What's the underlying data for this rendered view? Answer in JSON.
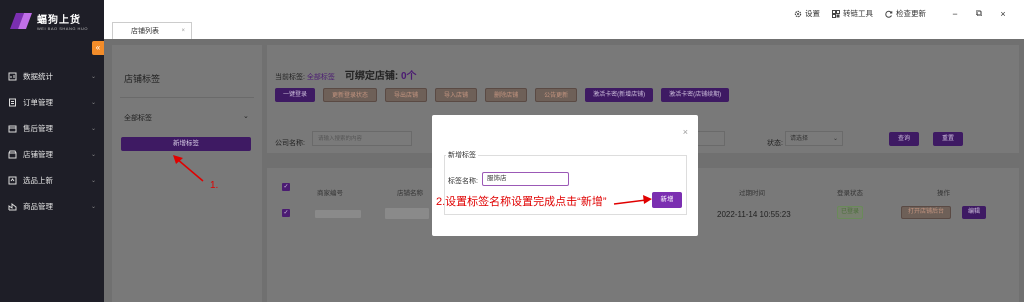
{
  "app": {
    "logo_title": "蝠狗上货",
    "logo_subtitle": "WEI BAO SHANG HUO"
  },
  "sidebar": {
    "collapse_glyph": "«",
    "items": [
      {
        "label": "数据统计",
        "icon": "chart-icon"
      },
      {
        "label": "订单管理",
        "icon": "order-icon"
      },
      {
        "label": "售后管理",
        "icon": "after-sales-icon"
      },
      {
        "label": "店铺管理",
        "icon": "store-icon"
      },
      {
        "label": "选品上新",
        "icon": "upload-icon"
      },
      {
        "label": "商品管理",
        "icon": "goods-icon"
      }
    ]
  },
  "tabs": [
    {
      "label": "店铺列表",
      "close": "×"
    }
  ],
  "toolbar": {
    "settings": "设置",
    "link_tool": "转链工具",
    "check_update": "检查更新",
    "minimize": "−",
    "restore": "⧉",
    "close": "×"
  },
  "left_panel": {
    "title": "店铺标签",
    "all_tags": "全部标签",
    "add_tag_button": "新增标签"
  },
  "annotation1": "1.",
  "main": {
    "current_tag_label": "当前标签:",
    "current_tag_value": "全部标签",
    "bound_label": "可绑定店铺:",
    "bound_count": "0个",
    "buttons": [
      {
        "label": "一键登录",
        "style": "primary"
      },
      {
        "label": "更新登录状态",
        "style": "outline"
      },
      {
        "label": "导出店铺",
        "style": "outline"
      },
      {
        "label": "导入店铺",
        "style": "outline"
      },
      {
        "label": "删除店铺",
        "style": "outline"
      },
      {
        "label": "公告更新",
        "style": "outline"
      },
      {
        "label": "激活卡密(新增店铺)",
        "style": "primary"
      },
      {
        "label": "激活卡密(店铺续期)",
        "style": "primary"
      }
    ]
  },
  "filter": {
    "company_label": "公司名称:",
    "company_placeholder": "请输入搜索的内容",
    "status_label": "状态:",
    "status_value": "请选择",
    "query_button": "查询",
    "reset_button": "重置"
  },
  "table": {
    "headers": [
      "商家编号",
      "店铺名称",
      "过期时间",
      "登录状态",
      "操作"
    ],
    "row": {
      "expire_time": "2022-11-14 10:55:23",
      "login_status": "已登录",
      "open_backend": "打开店铺后台",
      "edit": "编辑"
    }
  },
  "modal": {
    "legend": "新增标签",
    "name_label": "标签名称:",
    "name_value": "服饰店",
    "submit_button": "新增",
    "close": "×"
  },
  "annotation2": "2.设置标签名称设置完成点击“新增”",
  "colors": {
    "primary": "#7b2fb1",
    "sidebar": "#1e1e27",
    "annotation": "#e00000",
    "collapse": "#f28c2a"
  }
}
